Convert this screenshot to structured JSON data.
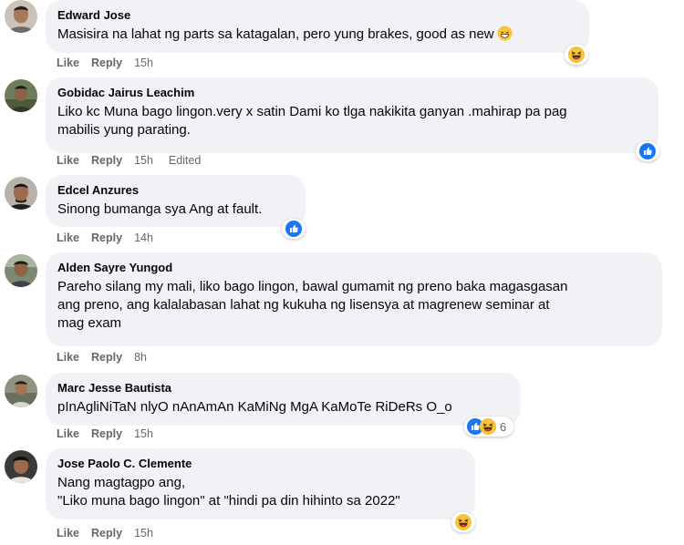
{
  "actions": {
    "like": "Like",
    "reply": "Reply"
  },
  "comments": [
    {
      "author": "Edward Jose",
      "text": "Masisira na lahat ng parts sa katagalan, pero yung brakes, good as new",
      "time": "15h",
      "reactions": {
        "icons": [
          "haha-icon"
        ],
        "count": ""
      }
    },
    {
      "author": "Gobidac Jairus Leachim",
      "text": "Liko kc Muna bago lingon.very x satin Dami ko tlga nakikita ganyan .mahirap pa pag\nmabilis yung parating.",
      "time": "15h",
      "edited": "Edited",
      "reactions": {
        "icons": [
          "like-icon"
        ],
        "count": ""
      }
    },
    {
      "author": "Edcel Anzures",
      "text": "Sinong bumanga sya Ang at fault.",
      "time": "14h",
      "reactions": {
        "icons": [
          "like-icon"
        ],
        "count": ""
      }
    },
    {
      "author": "Alden Sayre Yungod",
      "text": "Pareho silang my mali, liko bago lingon, bawal gumamit ng preno baka magasgasan\nang preno, ang kalalabasan lahat ng kukuha ng lisensya at magrenew seminar at\nmag exam",
      "time": "8h"
    },
    {
      "author": "Marc Jesse Bautista",
      "text": "pInAgliNiTaN nlyO nAnAmAn KaMiNg MgA KaMoTe RiDeRs O_o",
      "time": "15h",
      "reactions": {
        "icons": [
          "like-icon",
          "haha-icon"
        ],
        "count": "6"
      }
    },
    {
      "author": "Jose Paolo C. Clemente",
      "text": "Nang magtagpo ang,\n\"Liko muna bago lingon\" at \"hindi pa din hihinto sa 2022\"",
      "time": "15h",
      "reactions": {
        "icons": [
          "haha-icon"
        ],
        "count": ""
      }
    }
  ],
  "colors": {
    "bubble": "#f0f2f5",
    "meta": "#65676b",
    "like_blue": "#1877f2",
    "haha_yellow": "#f7c33b"
  }
}
